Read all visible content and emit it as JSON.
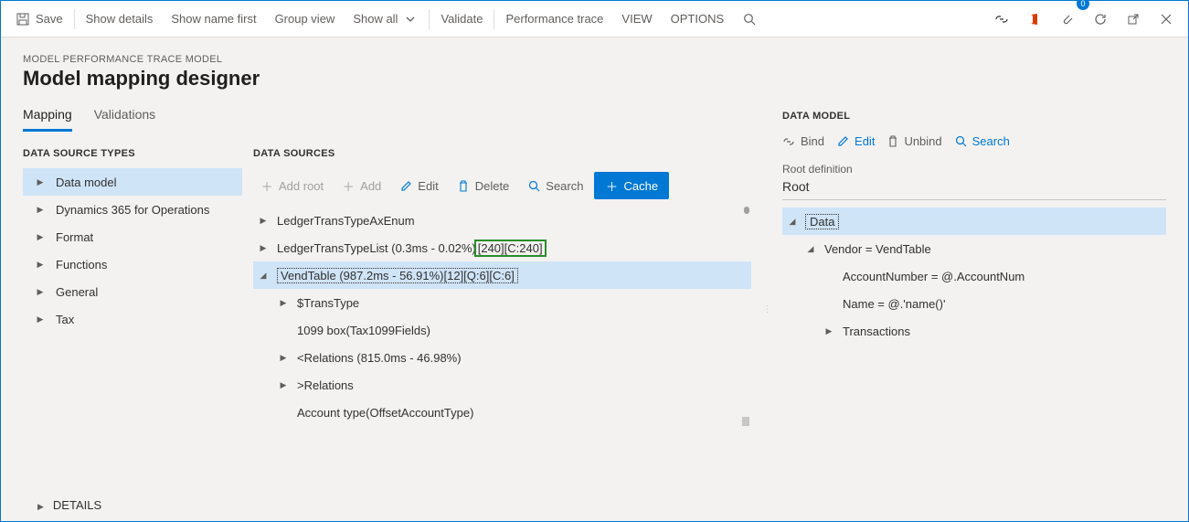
{
  "cmdbar": {
    "save": "Save",
    "show_details": "Show details",
    "show_name_first": "Show name first",
    "group_view": "Group view",
    "show_all": "Show all",
    "validate": "Validate",
    "perf_trace": "Performance trace",
    "view": "VIEW",
    "options": "OPTIONS",
    "badge_count": "0"
  },
  "breadcrumb": "MODEL PERFORMANCE TRACE MODEL",
  "page_title": "Model mapping designer",
  "tabs": {
    "mapping": "Mapping",
    "validations": "Validations"
  },
  "types": {
    "header": "DATA SOURCE TYPES",
    "items": [
      "Data model",
      "Dynamics 365 for Operations",
      "Format",
      "Functions",
      "General",
      "Tax"
    ]
  },
  "sources": {
    "header": "DATA SOURCES",
    "toolbar": {
      "add_root": "Add root",
      "add": "Add",
      "edit": "Edit",
      "delete": "Delete",
      "search": "Search",
      "cache": "Cache"
    },
    "rows": {
      "ax_enum": "LedgerTransTypeAxEnum",
      "list_label": "LedgerTransTypeList (0.3ms - 0.02%)",
      "list_metrics": "[240][C:240]",
      "vendtable": "VendTable (987.2ms - 56.91%)[12][Q:6][C:6]",
      "transtype": "$TransType",
      "box1099": "1099 box(Tax1099Fields)",
      "lt_relations": "<Relations (815.0ms - 46.98%)",
      "gt_relations": ">Relations",
      "accounttype": "Account type(OffsetAccountType)"
    }
  },
  "model": {
    "header": "DATA MODEL",
    "toolbar": {
      "bind": "Bind",
      "edit": "Edit",
      "unbind": "Unbind",
      "search": "Search"
    },
    "root_label": "Root definition",
    "root_value": "Root",
    "rows": {
      "data": "Data",
      "vendor": "Vendor = VendTable",
      "account": "AccountNumber = @.AccountNum",
      "name": "Name = @.'name()'",
      "trans": "Transactions"
    }
  },
  "details": "DETAILS"
}
